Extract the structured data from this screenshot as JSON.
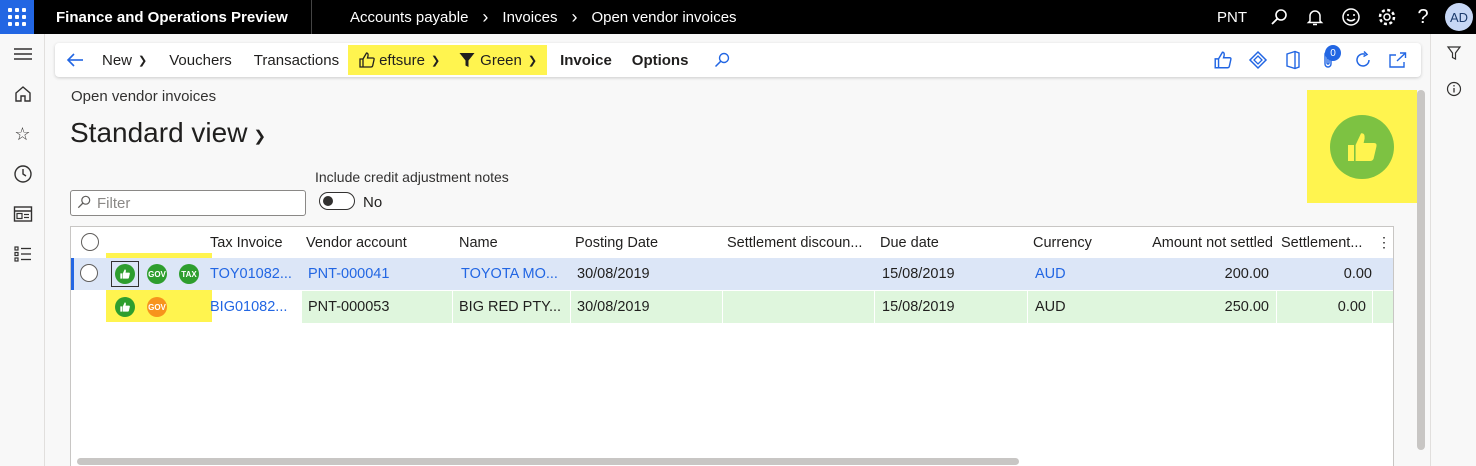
{
  "topbar": {
    "app_title": "Finance and Operations Preview",
    "breadcrumbs": [
      "Accounts payable",
      "Invoices",
      "Open vendor invoices"
    ],
    "company": "PNT",
    "user_initials": "AD"
  },
  "actionpane": {
    "new": "New",
    "vouchers": "Vouchers",
    "transactions": "Transactions",
    "eftsure": "eftsure",
    "green": "Green",
    "invoice": "Invoice",
    "options": "Options",
    "attachment_count": "0"
  },
  "page": {
    "caption": "Open vendor invoices",
    "view_name": "Standard view",
    "filter_placeholder": "Filter",
    "toggle_label": "Include credit adjustment notes",
    "toggle_value": "No"
  },
  "grid": {
    "columns": {
      "tax_invoice": "Tax Invoice",
      "vendor_account": "Vendor account",
      "name": "Name",
      "posting_date": "Posting Date",
      "settlement_discount": "Settlement discoun...",
      "due_date": "Due date",
      "currency": "Currency",
      "amount_not_settled": "Amount not settled",
      "settlement": "Settlement..."
    },
    "rows": [
      {
        "tax_invoice": "TOY01082...",
        "vendor_account": "PNT-000041",
        "name": "TOYOTA MO...",
        "posting_date": "30/08/2019",
        "settlement_discount": "",
        "due_date": "15/08/2019",
        "currency": "AUD",
        "amount_not_settled": "200.00",
        "settlement": "0.00",
        "status": {
          "gov": "GOV",
          "tax": "TAX"
        }
      },
      {
        "tax_invoice": "BIG01082...",
        "vendor_account": "PNT-000053",
        "name": "BIG RED PTY...",
        "posting_date": "30/08/2019",
        "settlement_discount": "",
        "due_date": "15/08/2019",
        "currency": "AUD",
        "amount_not_settled": "250.00",
        "settlement": "0.00",
        "status": {
          "gov": "GOV"
        }
      }
    ]
  },
  "colors": {
    "accent": "#2266e3",
    "highlight": "#fff44f",
    "selected_row": "#dce6f7",
    "verified_row": "#dff6dd",
    "status_green": "#2e9e2e",
    "status_orange": "#f7941d",
    "thumb_green": "#7dc242"
  },
  "icons": {
    "topbar": [
      "app-launcher-icon",
      "search-icon",
      "bell-icon",
      "smiley-icon",
      "gear-icon",
      "help-icon"
    ],
    "left_rail": [
      "hamburger-icon",
      "home-icon",
      "star-icon",
      "clock-icon",
      "workspace-icon",
      "list-icon"
    ],
    "right_rail": [
      "filter-icon",
      "info-icon"
    ],
    "action_pane_right": [
      "thumbs-up-icon",
      "diamond-icon",
      "office-icon",
      "paperclip-icon",
      "refresh-icon",
      "open-new-icon"
    ]
  }
}
